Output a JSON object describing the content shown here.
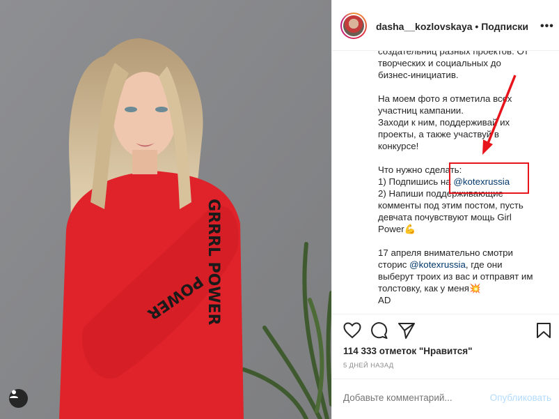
{
  "post": {
    "username": "dasha__kozlovskaya",
    "follow_text": " • Подписки",
    "more_icon": "more-horizontal-icon",
    "caption_lines": [
      {
        "text": "создательниц разных проектов. От"
      },
      {
        "text": "творческих и социальных до"
      },
      {
        "text": "бизнес-инициатив."
      },
      {
        "text": ""
      },
      {
        "text": "На моем фото я отметила всех"
      },
      {
        "text": "участниц кампании."
      },
      {
        "text": "Заходи к ним, поддерживай их"
      },
      {
        "text": "проекты, а также участвуй в"
      },
      {
        "text": "конкурсе!"
      },
      {
        "text": ""
      },
      {
        "text": "Что нужно сделать:"
      },
      {
        "pre": "1) Подпишись на ",
        "link": "@kotexrussia"
      },
      {
        "text": "2) Напиши поддерживающие"
      },
      {
        "text": "комменты под этим постом, пусть"
      },
      {
        "text": "девчата почувствуют мощь Girl"
      },
      {
        "text": "Power💪"
      },
      {
        "text": ""
      },
      {
        "text": "17 апреля внимательно смотри"
      },
      {
        "pre": "сторис ",
        "link": "@kotexrussia",
        "post": ", где они"
      },
      {
        "text": "выберут троих из вас и отправят им"
      },
      {
        "text": "толстовку, как у меня💥"
      },
      {
        "text": "AD"
      }
    ],
    "likes": "114 333 отметок \"Нравится\"",
    "date": "5 ДНЕЙ НАЗАД",
    "comment_placeholder": "Добавьте комментарий...",
    "publish_label": "Опубликовать",
    "sweater_text": "GRRRL POWER",
    "colors": {
      "link": "#00376b",
      "annotation": "#e8141b",
      "publish_disabled": "#b3dbff",
      "sweater": "#e0222a"
    },
    "icons": [
      "heart-icon",
      "comment-icon",
      "share-icon",
      "bookmark-icon",
      "user-tag-icon"
    ]
  }
}
